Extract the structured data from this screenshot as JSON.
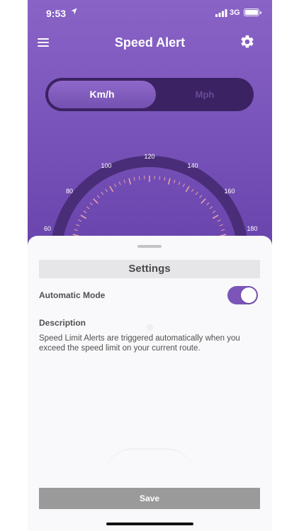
{
  "status_bar": {
    "time": "9:53",
    "network": "3G",
    "icons": [
      "location-arrow-icon",
      "signal-icon",
      "battery-icon"
    ]
  },
  "nav": {
    "title": "Speed Alert",
    "left_icon": "menu-icon",
    "right_icon": "gear-icon"
  },
  "units": {
    "selected": "Km/h",
    "options": [
      "Km/h",
      "Mph"
    ]
  },
  "gauge": {
    "tick_labels": [
      "60",
      "80",
      "100",
      "120",
      "140",
      "160",
      "180"
    ]
  },
  "settings": {
    "header": "Settings",
    "automatic_mode_label": "Automatic Mode",
    "automatic_mode_on": true,
    "description_title": "Description",
    "description_text": "Speed Limit Alerts are triggered automatically when you exceed the speed limit on your current route.",
    "save_label": "Save"
  },
  "colors": {
    "primary": "#7b55b8",
    "segment_bg": "#3b2262",
    "sheet_bg": "#f9f9fb",
    "save_button": "#9a9a9a"
  }
}
